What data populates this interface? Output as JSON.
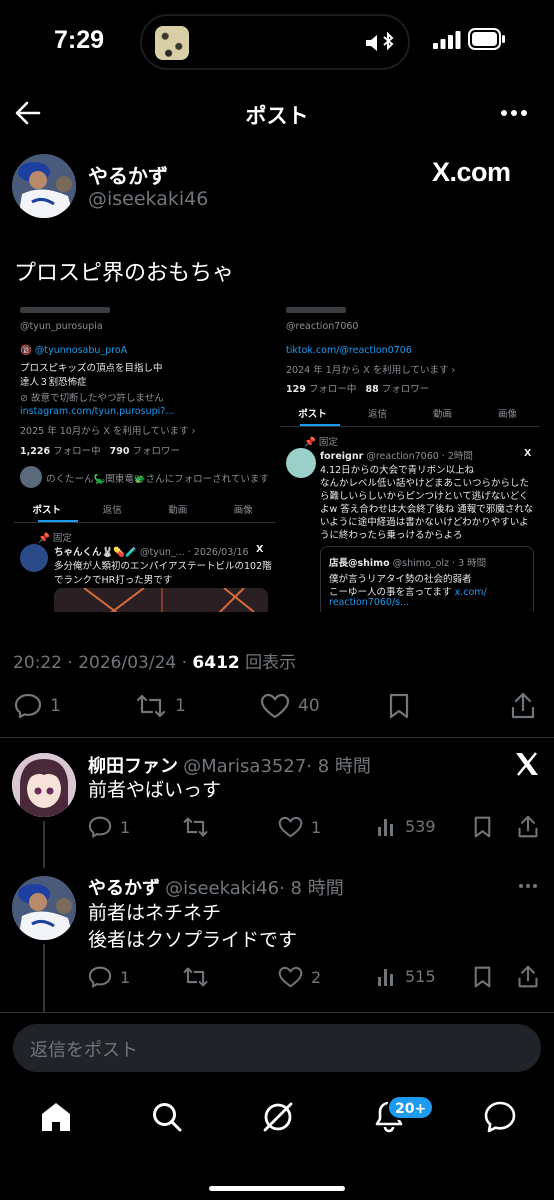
{
  "status_bar": {
    "time": "7:29"
  },
  "header": {
    "title": "ポスト"
  },
  "post": {
    "author_name": "やるかず",
    "author_handle": "@iseekaki46",
    "source_logo": "X.com",
    "text": "プロスピ界のおもちゃ",
    "time": "20:22",
    "date": "2026/03/24",
    "views_count": "6412",
    "views_label": "回表示",
    "actions": {
      "replies": "1",
      "reposts": "1",
      "likes": "40"
    }
  },
  "embedded_image": {
    "left": {
      "handle": "@tyun_purosupia",
      "link1": "🔞 @tyunnosabu_proA",
      "bio1": "プロスピキッズの頂点を目指し中",
      "bio2": "達人３割恐怖症",
      "warn": "⊘ 故意で切断したやつ許しません",
      "link2": "instagram.com/tyun.purosupi?...",
      "joined": "2025 年 10月から X を利用しています ›",
      "following_count": "1,226",
      "following_label": "フォロー中",
      "followers_count": "790",
      "followers_label": "フォロワー",
      "followed_by": "のくたーん🦕関東竜🐲さんにフォローされています",
      "tabs": [
        "ポスト",
        "返信",
        "動画",
        "画像"
      ],
      "pinned": "固定",
      "tweet_name": "ちゃんくん🐰💊🧪",
      "tweet_meta": "@tyun_... · 2026/03/16",
      "tweet_line1": "多分俺が人類初のエンパイアステートビルの102階",
      "tweet_line2": "でランクでHR打った男です"
    },
    "right": {
      "handle": "@reaction7060",
      "link": "tiktok.com/@reaction0706",
      "joined": "2024 年 1月から X を利用しています ›",
      "following_count": "129",
      "following_label": "フォロー中",
      "followers_count": "88",
      "followers_label": "フォロワー",
      "tabs": [
        "ポスト",
        "返信",
        "動画",
        "画像"
      ],
      "pinned": "固定",
      "tweet_name": "foreignr",
      "tweet_meta": "@reaction7060 · 2時間",
      "tweet_lines": [
        "4.12日からの大会で青リボン以上ね",
        "なんかレベル低い話やけどまあこいつらからした",
        "ら難しいらしいからピンつけといて逃げないどく",
        "よw 答え合わせは大会終了後ね 通報で邪魔されな",
        "いように途中経過は書かないけどわかりやすいよ",
        "うに終わったら乗っけるからよろ"
      ],
      "quote_name": "店長@shimo",
      "quote_meta": "@shimo_olz · 3 時間",
      "quote_line1": "僕が言うリアタイ勢の社会的弱者",
      "quote_line2": "こーゆー人の事を言ってます",
      "quote_link": "x.com/",
      "quote_link2": "reaction7060/s..."
    }
  },
  "replies": [
    {
      "name": "柳田ファン",
      "handle": "@Marisa3527",
      "time": "· 8 時間",
      "text_lines": [
        "前者やばいっす"
      ],
      "replies": "1",
      "reposts": "",
      "likes": "1",
      "views": "539"
    },
    {
      "name": "やるかず",
      "handle": "@iseekaki46",
      "time": "· 8 時間",
      "text_lines": [
        "前者はネチネチ",
        "後者はクソプライドです"
      ],
      "replies": "1",
      "reposts": "",
      "likes": "2",
      "views": "515"
    }
  ],
  "reply_box": {
    "placeholder": "返信をポスト"
  },
  "bottom_nav": {
    "notifications_badge": "20+"
  },
  "colors": {
    "background": "#000000",
    "accent": "#1d9bf0",
    "muted": "#71767b"
  }
}
